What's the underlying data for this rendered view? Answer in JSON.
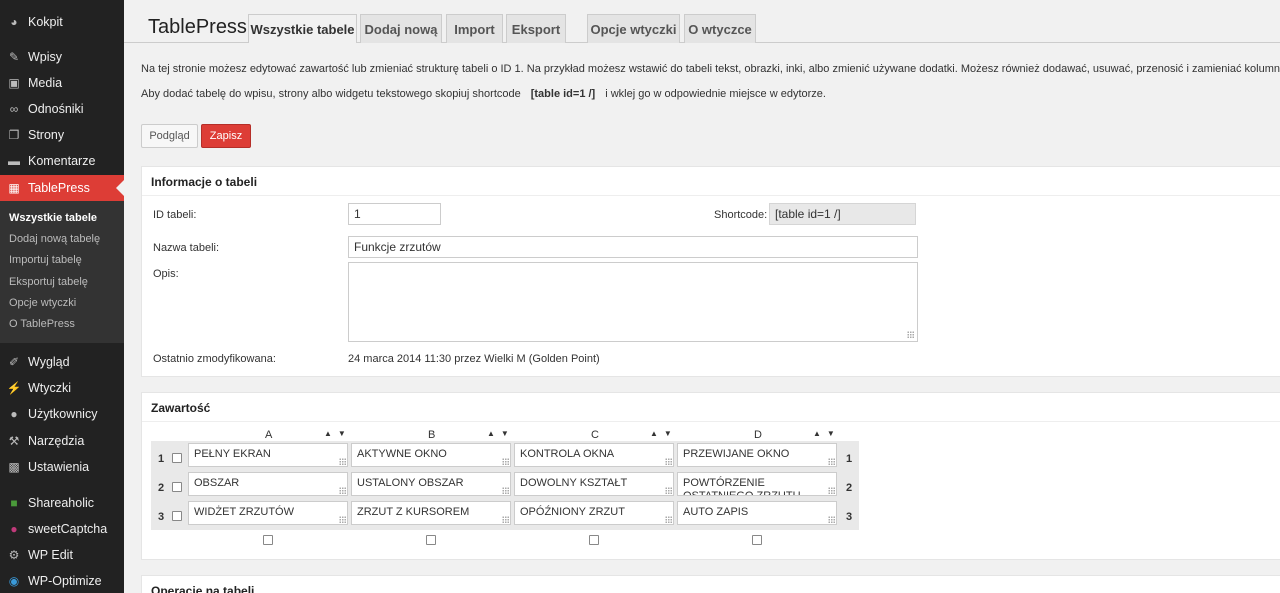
{
  "sidebar": {
    "items": [
      {
        "label": "Kokpit",
        "icon": "dashboard-icon"
      },
      {
        "label": "Wpisy",
        "icon": "pin-icon"
      },
      {
        "label": "Media",
        "icon": "media-icon"
      },
      {
        "label": "Odnośniki",
        "icon": "link-icon"
      },
      {
        "label": "Strony",
        "icon": "pages-icon"
      },
      {
        "label": "Komentarze",
        "icon": "comment-icon"
      },
      {
        "label": "TablePress",
        "icon": "table-icon"
      },
      {
        "label": "Wygląd",
        "icon": "brush-icon"
      },
      {
        "label": "Wtyczki",
        "icon": "plugin-icon"
      },
      {
        "label": "Użytkownicy",
        "icon": "user-icon"
      },
      {
        "label": "Narzędzia",
        "icon": "wrench-icon"
      },
      {
        "label": "Ustawienia",
        "icon": "settings-icon"
      },
      {
        "label": "Shareaholic",
        "icon": "shareaholic-icon"
      },
      {
        "label": "sweetCaptcha",
        "icon": "sweetcaptcha-icon"
      },
      {
        "label": "WP Edit",
        "icon": "gear-icon"
      },
      {
        "label": "WP-Optimize",
        "icon": "optimize-icon"
      }
    ],
    "submenu": [
      "Wszystkie tabele",
      "Dodaj nową tabelę",
      "Importuj tabelę",
      "Eksportuj tabelę",
      "Opcje wtyczki",
      "O TablePress"
    ]
  },
  "header": {
    "title": "TablePress",
    "tabs": [
      "Wszystkie tabele",
      "Dodaj nową",
      "Import",
      "Eksport",
      "Opcje wtyczki",
      "O wtyczce"
    ]
  },
  "intro": {
    "line1": "Na tej stronie możesz edytować zawartość lub zmieniać strukturę tabeli o ID 1. Na przykład możesz wstawić do tabeli tekst, obrazki, inki, albo zmienić używane dodatki. Możesz również dodawać, usuwać, przenosić i zamieniać kolumny i wiersze.",
    "line2_before": "Aby dodać tabelę do wpisu, strony albo widgetu tekstowego skopiuj shortcode",
    "shortcode": "[table id=1 /]",
    "line2_after": "i wklej go w odpowiednie miejsce w edytorze."
  },
  "buttons": {
    "preview": "Podgląd",
    "save": "Zapisz"
  },
  "table_info": {
    "title": "Informacje o tabeli",
    "id_label": "ID tabeli:",
    "id_value": "1",
    "shortcode_label": "Shortcode:",
    "shortcode_value": "[table id=1 /]",
    "name_label": "Nazwa tabeli:",
    "name_value": "Funkcje zrzutów",
    "desc_label": "Opis:",
    "desc_value": "",
    "modified_label": "Ostatnio zmodyfikowana:",
    "modified_value": "24 marca 2014 11:30 przez Wielki M (Golden Point)"
  },
  "content": {
    "title": "Zawartość",
    "columns": [
      "A",
      "B",
      "C",
      "D"
    ],
    "rows": [
      {
        "num": "1",
        "cells": [
          "PEŁNY EKRAN",
          "AKTYWNE OKNO",
          "KONTROLA OKNA",
          "PRZEWIJANE OKNO"
        ]
      },
      {
        "num": "2",
        "cells": [
          "OBSZAR",
          "USTALONY OBSZAR",
          "DOWOLNY KSZTAŁT",
          "POWTÓRZENIE OSTATNIEGO ZRZUTU"
        ]
      },
      {
        "num": "3",
        "cells": [
          "WIDŻET ZRZUTÓW",
          "ZRZUT Z KURSOREM",
          "OPÓŹNIONY ZRZUT",
          "AUTO ZAPIS"
        ]
      }
    ]
  },
  "operations": {
    "title": "Operacje na tabeli"
  },
  "colors": {
    "accent": "#dd3d36",
    "sidebar_bg": "#222222",
    "submenu_bg": "#333333"
  }
}
